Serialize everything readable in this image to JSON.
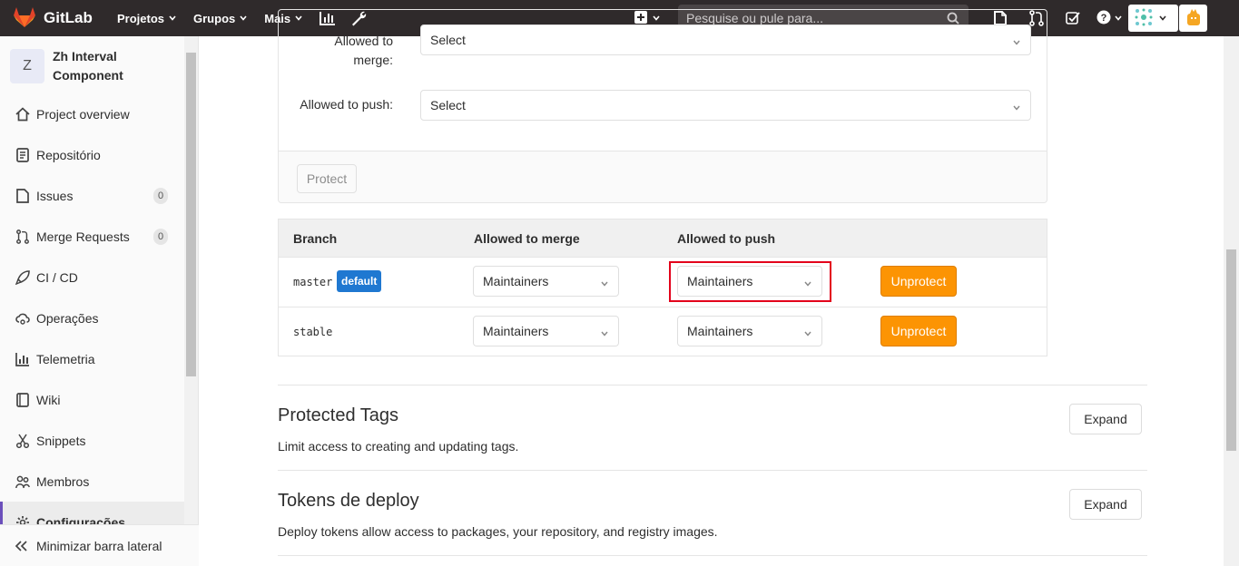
{
  "navbar": {
    "brand": "GitLab",
    "menu": [
      {
        "label": "Projetos"
      },
      {
        "label": "Grupos"
      },
      {
        "label": "Mais"
      }
    ],
    "search_placeholder": "Pesquise ou pule para..."
  },
  "sidebar": {
    "project_initial": "Z",
    "project_name": "Zh Interval Component",
    "items": [
      {
        "label": "Project overview",
        "icon": "home-icon"
      },
      {
        "label": "Repositório",
        "icon": "document-icon"
      },
      {
        "label": "Issues",
        "icon": "issues-icon",
        "count": "0"
      },
      {
        "label": "Merge Requests",
        "icon": "merge-request-icon",
        "count": "0"
      },
      {
        "label": "CI / CD",
        "icon": "rocket-icon"
      },
      {
        "label": "Operações",
        "icon": "cloud-gear-icon"
      },
      {
        "label": "Telemetria",
        "icon": "chart-icon"
      },
      {
        "label": "Wiki",
        "icon": "book-icon"
      },
      {
        "label": "Snippets",
        "icon": "scissors-icon"
      },
      {
        "label": "Membros",
        "icon": "users-icon"
      },
      {
        "label": "Configurações",
        "icon": "gear-icon"
      }
    ],
    "collapse_label": "Minimizar barra lateral"
  },
  "form": {
    "allowed_merge_label": "Allowed to merge:",
    "allowed_merge_value": "Select",
    "allowed_push_label": "Allowed to push:",
    "allowed_push_value": "Select",
    "protect_button": "Protect"
  },
  "branches": {
    "headers": {
      "branch": "Branch",
      "merge": "Allowed to merge",
      "push": "Allowed to push"
    },
    "default_badge": "default",
    "unprotect_label": "Unprotect",
    "rows": [
      {
        "name": "master",
        "merge": "Maintainers",
        "push": "Maintainers"
      },
      {
        "name": "stable",
        "merge": "Maintainers",
        "push": "Maintainers"
      }
    ]
  },
  "sections": [
    {
      "title": "Protected Tags",
      "desc": "Limit access to creating and updating tags.",
      "button": "Expand"
    },
    {
      "title": "Tokens de deploy",
      "desc": "Deploy tokens allow access to packages, your repository, and registry images.",
      "button": "Expand"
    }
  ],
  "colors": {
    "accent": "#fc9403",
    "badge": "#1f78d1",
    "highlight": "#e3001b",
    "navbar": "#2f2a2b"
  }
}
